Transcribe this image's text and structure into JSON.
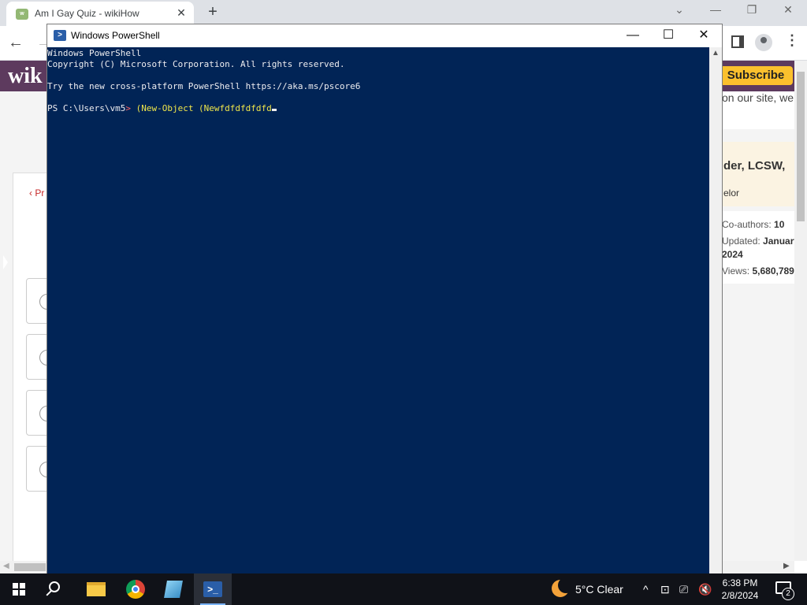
{
  "browser": {
    "tab_title": "Am I Gay Quiz - wikiHow",
    "tab_favicon": "wikiHow",
    "tab_close": "✕",
    "new_tab": "+",
    "site_logo": "wik",
    "subscribe_label": "Subscribe",
    "prev_label": "‹ Pr",
    "right_snippet": "on our site, we",
    "expert_name": "der, LCSW,",
    "expert_role": "elor",
    "stats": [
      {
        "label": "Co-authors: ",
        "value": "10"
      },
      {
        "label": "Updated: ",
        "value": "January"
      },
      {
        "label": "",
        "value": "2024"
      },
      {
        "label": "Views: ",
        "value": "5,680,789"
      }
    ]
  },
  "powershell": {
    "title": "Windows PowerShell",
    "icon": "powershell-icon",
    "lines": [
      "Windows PowerShell",
      "Copyright (C) Microsoft Corporation. All rights reserved.",
      "",
      "Try the new cross-platform PowerShell https://aka.ms/pscore6",
      ""
    ],
    "prompt": "PS C:\\Users\\vm5",
    "prompt_arrow": ">",
    "command": " (New-Object (Newfdfdfdfdfd",
    "minimize": "—",
    "maximize": "☐",
    "close": "✕"
  },
  "taskbar": {
    "weather": "5°C  Clear",
    "time": "6:38 PM",
    "date": "2/8/2024",
    "notification_count": "2",
    "tray_chevron": "^"
  },
  "colors": {
    "ps_background": "#012456",
    "ps_text": "#eeedf0",
    "ps_command": "#f0e64a",
    "wikihow_header": "#5d3a5e",
    "subscribe": "#fbc02d"
  }
}
